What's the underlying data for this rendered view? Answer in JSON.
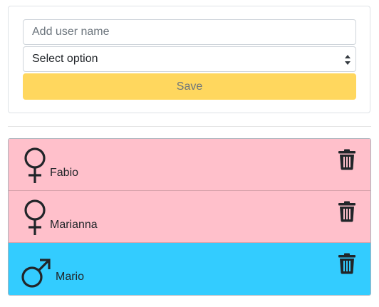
{
  "form": {
    "name_placeholder": "Add user name",
    "select_value": "Select option",
    "save_label": "Save"
  },
  "users": [
    {
      "name": "Fabio",
      "gender": "female",
      "color": "#ffc0cb"
    },
    {
      "name": "Marianna",
      "gender": "female",
      "color": "#ffc0cb"
    },
    {
      "name": "Mario",
      "gender": "male",
      "color": "#33ccff"
    }
  ],
  "icons": {
    "female": "female-symbol-icon",
    "male": "male-symbol-icon",
    "delete": "trash-icon"
  },
  "colors": {
    "save_button": "#ffd75e",
    "female_row": "#ffc0cb",
    "male_row": "#33ccff"
  }
}
